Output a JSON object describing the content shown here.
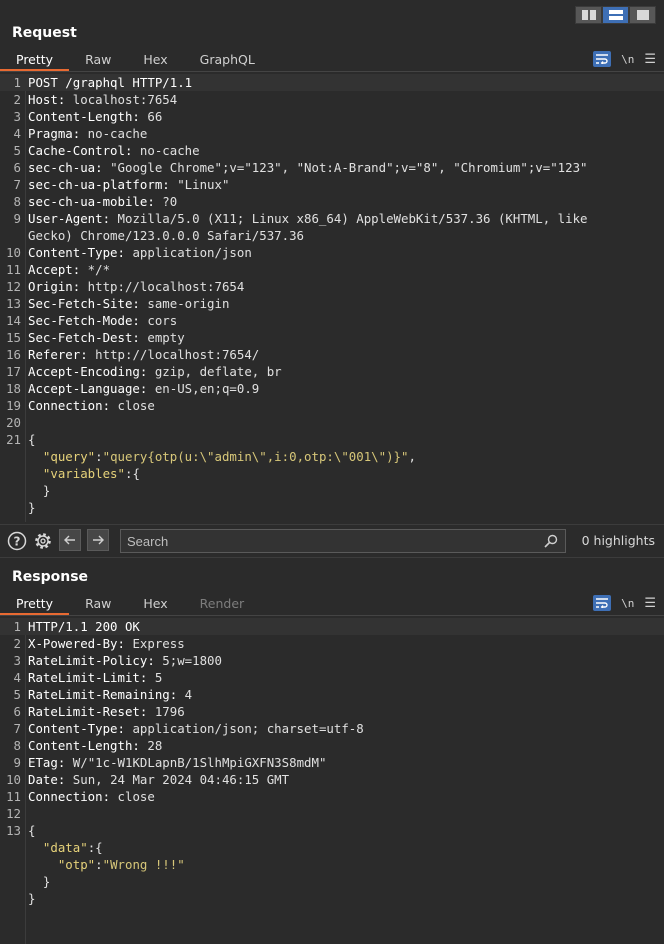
{
  "layout_buttons": [
    {
      "name": "layout-side-by-side",
      "active": false
    },
    {
      "name": "layout-stacked",
      "active": true
    },
    {
      "name": "layout-tabs",
      "active": false
    }
  ],
  "request": {
    "title": "Request",
    "tabs": [
      "Pretty",
      "Raw",
      "Hex",
      "GraphQL"
    ],
    "active_tab": "Pretty",
    "wrap_icon": "wrap-lines-icon",
    "newline_label": "\\n",
    "menu_icon": "hamburger-menu-icon",
    "lines": [
      [
        {
          "t": "k",
          "s": "POST /graphql HTTP/1.1"
        }
      ],
      [
        {
          "t": "k",
          "s": "Host:"
        },
        {
          "t": "v",
          "s": " localhost:7654"
        }
      ],
      [
        {
          "t": "k",
          "s": "Content-Length:"
        },
        {
          "t": "v",
          "s": " 66"
        }
      ],
      [
        {
          "t": "k",
          "s": "Pragma:"
        },
        {
          "t": "v",
          "s": " no-cache"
        }
      ],
      [
        {
          "t": "k",
          "s": "Cache-Control:"
        },
        {
          "t": "v",
          "s": " no-cache"
        }
      ],
      [
        {
          "t": "k",
          "s": "sec-ch-ua:"
        },
        {
          "t": "v",
          "s": " \"Google Chrome\";v=\"123\", \"Not:A-Brand\";v=\"8\", \"Chromium\";v=\"123\""
        }
      ],
      [
        {
          "t": "k",
          "s": "sec-ch-ua-platform:"
        },
        {
          "t": "v",
          "s": " \"Linux\""
        }
      ],
      [
        {
          "t": "k",
          "s": "sec-ch-ua-mobile:"
        },
        {
          "t": "v",
          "s": " ?0"
        }
      ],
      [
        {
          "t": "k",
          "s": "User-Agent:"
        },
        {
          "t": "v",
          "s": " Mozilla/5.0 (X11; Linux x86_64) AppleWebKit/537.36 (KHTML, like"
        }
      ],
      [
        {
          "t": "v",
          "s": "Gecko) Chrome/123.0.0.0 Safari/537.36"
        }
      ],
      [
        {
          "t": "k",
          "s": "Content-Type:"
        },
        {
          "t": "v",
          "s": " application/json"
        }
      ],
      [
        {
          "t": "k",
          "s": "Accept:"
        },
        {
          "t": "v",
          "s": " */*"
        }
      ],
      [
        {
          "t": "k",
          "s": "Origin:"
        },
        {
          "t": "v",
          "s": " http://localhost:7654"
        }
      ],
      [
        {
          "t": "k",
          "s": "Sec-Fetch-Site:"
        },
        {
          "t": "v",
          "s": " same-origin"
        }
      ],
      [
        {
          "t": "k",
          "s": "Sec-Fetch-Mode:"
        },
        {
          "t": "v",
          "s": " cors"
        }
      ],
      [
        {
          "t": "k",
          "s": "Sec-Fetch-Dest:"
        },
        {
          "t": "v",
          "s": " empty"
        }
      ],
      [
        {
          "t": "k",
          "s": "Referer:"
        },
        {
          "t": "v",
          "s": " http://localhost:7654/"
        }
      ],
      [
        {
          "t": "k",
          "s": "Accept-Encoding:"
        },
        {
          "t": "v",
          "s": " gzip, deflate, br"
        }
      ],
      [
        {
          "t": "k",
          "s": "Accept-Language:"
        },
        {
          "t": "v",
          "s": " en-US,en;q=0.9"
        }
      ],
      [
        {
          "t": "k",
          "s": "Connection:"
        },
        {
          "t": "v",
          "s": " close"
        }
      ],
      [],
      [
        {
          "t": "p",
          "s": "{"
        }
      ],
      [
        {
          "t": "p",
          "s": "  "
        },
        {
          "t": "j",
          "s": "\"query\""
        },
        {
          "t": "p",
          "s": ":"
        },
        {
          "t": "js",
          "s": "\"query{otp(u:\\\"admin\\\",i:0,otp:\\\"001\\\")}\""
        },
        {
          "t": "p",
          "s": ","
        }
      ],
      [
        {
          "t": "p",
          "s": "  "
        },
        {
          "t": "j",
          "s": "\"variables\""
        },
        {
          "t": "p",
          "s": ":{"
        }
      ],
      [
        {
          "t": "p",
          "s": "  }"
        }
      ],
      [
        {
          "t": "p",
          "s": "}"
        }
      ]
    ],
    "line_numbers": [
      "1",
      "2",
      "3",
      "4",
      "5",
      "6",
      "7",
      "8",
      "9",
      "",
      "10",
      "11",
      "12",
      "13",
      "14",
      "15",
      "16",
      "17",
      "18",
      "19",
      "20",
      "21",
      "",
      "",
      "",
      ""
    ]
  },
  "search": {
    "help_icon": "help-icon",
    "settings_icon": "gear-icon",
    "back_icon": "arrow-left-icon",
    "forward_icon": "arrow-right-icon",
    "placeholder": "Search",
    "value": "",
    "highlights": "0 highlights"
  },
  "response": {
    "title": "Response",
    "tabs": [
      "Pretty",
      "Raw",
      "Hex",
      "Render"
    ],
    "active_tab": "Pretty",
    "disabled_tabs": [
      "Render"
    ],
    "lines": [
      [
        {
          "t": "k",
          "s": "HTTP/1.1 200 OK"
        }
      ],
      [
        {
          "t": "k",
          "s": "X-Powered-By:"
        },
        {
          "t": "v",
          "s": " Express"
        }
      ],
      [
        {
          "t": "k",
          "s": "RateLimit-Policy:"
        },
        {
          "t": "v",
          "s": " 5;w=1800"
        }
      ],
      [
        {
          "t": "k",
          "s": "RateLimit-Limit:"
        },
        {
          "t": "v",
          "s": " 5"
        }
      ],
      [
        {
          "t": "k",
          "s": "RateLimit-Remaining:"
        },
        {
          "t": "v",
          "s": " 4"
        }
      ],
      [
        {
          "t": "k",
          "s": "RateLimit-Reset:"
        },
        {
          "t": "v",
          "s": " 1796"
        }
      ],
      [
        {
          "t": "k",
          "s": "Content-Type:"
        },
        {
          "t": "v",
          "s": " application/json; charset=utf-8"
        }
      ],
      [
        {
          "t": "k",
          "s": "Content-Length:"
        },
        {
          "t": "v",
          "s": " 28"
        }
      ],
      [
        {
          "t": "k",
          "s": "ETag:"
        },
        {
          "t": "v",
          "s": " W/\"1c-W1KDLapnB/1SlhMpiGXFN3S8mdM\""
        }
      ],
      [
        {
          "t": "k",
          "s": "Date:"
        },
        {
          "t": "v",
          "s": " Sun, 24 Mar 2024 04:46:15 GMT"
        }
      ],
      [
        {
          "t": "k",
          "s": "Connection:"
        },
        {
          "t": "v",
          "s": " close"
        }
      ],
      [],
      [
        {
          "t": "p",
          "s": "{"
        }
      ],
      [
        {
          "t": "p",
          "s": "  "
        },
        {
          "t": "j",
          "s": "\"data\""
        },
        {
          "t": "p",
          "s": ":{"
        }
      ],
      [
        {
          "t": "p",
          "s": "    "
        },
        {
          "t": "j",
          "s": "\"otp\""
        },
        {
          "t": "p",
          "s": ":"
        },
        {
          "t": "js",
          "s": "\"Wrong !!!\""
        }
      ],
      [
        {
          "t": "p",
          "s": "  }"
        }
      ],
      [
        {
          "t": "p",
          "s": "}"
        }
      ]
    ],
    "line_numbers": [
      "1",
      "2",
      "3",
      "4",
      "5",
      "6",
      "7",
      "8",
      "9",
      "10",
      "11",
      "12",
      "13",
      "",
      "",
      "",
      ""
    ]
  },
  "colors": {
    "accent": "#3e6fb5",
    "tab_underline": "#e86a32",
    "background": "#2b2b2b",
    "json_key": "#e6d27a"
  }
}
